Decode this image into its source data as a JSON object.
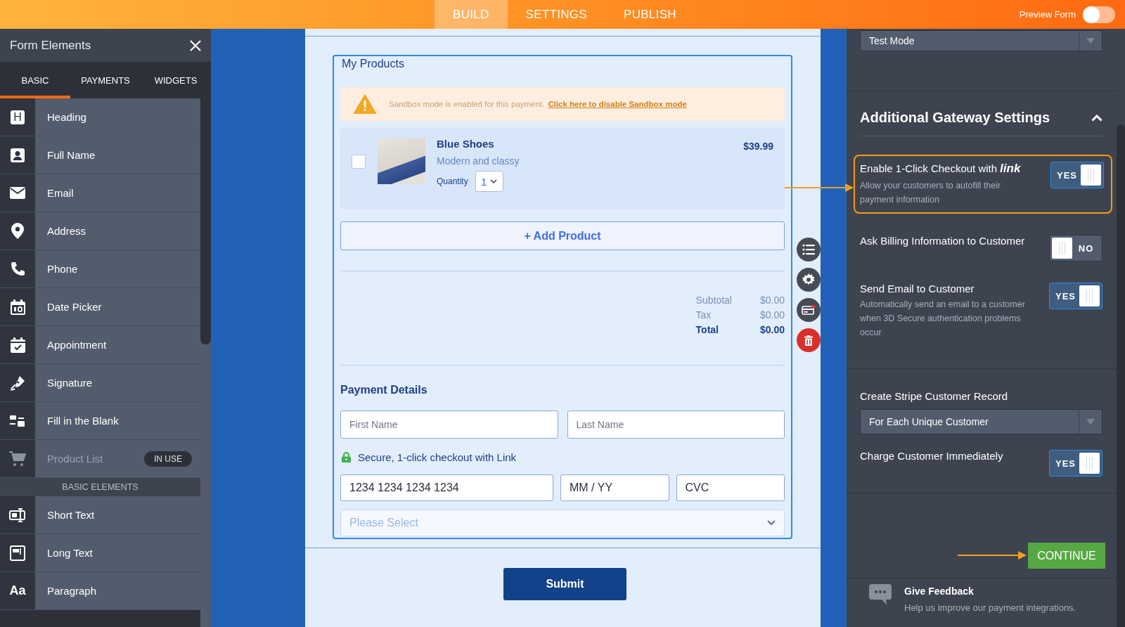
{
  "top_bar": {
    "tabs": [
      {
        "label": "BUILD",
        "selected": true
      },
      {
        "label": "SETTINGS",
        "selected": false
      },
      {
        "label": "PUBLISH",
        "selected": false
      }
    ],
    "preview": {
      "label": "Preview Form",
      "on": false
    }
  },
  "sidebar": {
    "title": "Form Elements",
    "tabs": [
      {
        "label": "BASIC",
        "selected": true
      },
      {
        "label": "PAYMENTS",
        "selected": false
      },
      {
        "label": "WIDGETS",
        "selected": false
      }
    ],
    "items": [
      {
        "label": "Heading",
        "glyph": "H",
        "disabled": false
      },
      {
        "label": "Full Name",
        "disabled": false
      },
      {
        "label": "Email",
        "disabled": false
      },
      {
        "label": "Address",
        "disabled": false
      },
      {
        "label": "Phone",
        "disabled": false
      },
      {
        "label": "Date Picker",
        "disabled": false
      },
      {
        "label": "Appointment",
        "disabled": false
      },
      {
        "label": "Signature",
        "disabled": false
      },
      {
        "label": "Fill in the Blank",
        "disabled": false
      },
      {
        "label": "Product List",
        "disabled": true,
        "badge": "IN USE"
      }
    ],
    "section_title": "BASIC ELEMENTS",
    "section_items": [
      {
        "label": "Short Text",
        "disabled": false
      },
      {
        "label": "Long Text",
        "disabled": false
      },
      {
        "label": "Paragraph",
        "glyph": "Aa",
        "disabled": false
      }
    ]
  },
  "form": {
    "products": {
      "title": "My Products",
      "notice": {
        "text": "Sandbox mode is enabled for this payment.",
        "link": "Click here to disable Sandbox mode"
      },
      "items": [
        {
          "name": "Blue Shoes",
          "description": "Modern and classy",
          "price": "$39.99",
          "quantity_label": "Quantity",
          "quantity": "1",
          "selected": false
        }
      ],
      "add_button": "+ Add Product",
      "totals": [
        {
          "label": "Subtotal",
          "value": "$0.00",
          "kind": "line"
        },
        {
          "label": "Tax",
          "value": "$0.00",
          "kind": "line"
        },
        {
          "label": "Total",
          "value": "$0.00",
          "kind": "total"
        }
      ]
    },
    "payment": {
      "title": "Payment Details",
      "first_name": {
        "placeholder": "First Name"
      },
      "last_name": {
        "placeholder": "Last Name"
      },
      "secure_note": "Secure, 1-click checkout with Link",
      "card_number": {
        "placeholder": "1234 1234 1234 1234"
      },
      "expiry": {
        "placeholder": "MM / YY"
      },
      "cvc": {
        "placeholder": "CVC"
      },
      "select": {
        "placeholder": "Please Select"
      }
    },
    "submit": "Submit"
  },
  "settings_panel": {
    "mode_select": {
      "value": "Test Mode"
    },
    "section": {
      "title": "Additional Gateway Settings",
      "expanded": true
    },
    "options": [
      {
        "kind": "toggle",
        "label": "Enable 1-Click Checkout with",
        "brand": "link",
        "description": "Allow your customers to autofill their payment information",
        "on": true,
        "toggle_text": "YES",
        "highlighted": true
      },
      {
        "kind": "toggle",
        "label": "Ask Billing Information to Customer",
        "on": false,
        "toggle_text": "NO",
        "highlighted": false
      },
      {
        "kind": "toggle",
        "label": "Send Email to Customer",
        "description": "Automatically send an email to a customer when 3D Secure authentication problems occur",
        "on": true,
        "toggle_text": "YES",
        "highlighted": false
      }
    ],
    "record": {
      "label": "Create Stripe Customer Record",
      "value": "For Each Unique Customer"
    },
    "charge": {
      "label": "Charge Customer Immediately",
      "on": true,
      "toggle_text": "YES"
    },
    "continue_button": "CONTINUE",
    "feedback": {
      "title": "Give Feedback",
      "text": "Help us improve our payment integrations."
    }
  }
}
